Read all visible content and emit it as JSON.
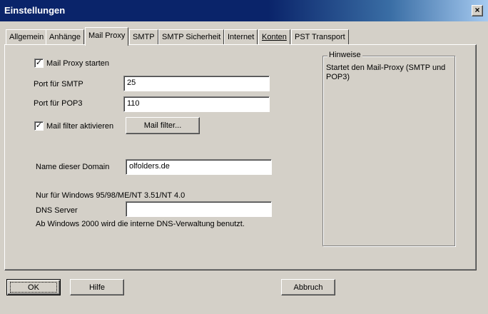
{
  "window": {
    "title": "Einstellungen"
  },
  "tabs": [
    {
      "label": "Allgemein"
    },
    {
      "label": "Anhänge"
    },
    {
      "label": "Mail Proxy"
    },
    {
      "label": "SMTP"
    },
    {
      "label": "SMTP Sicherheit"
    },
    {
      "label": "Internet"
    },
    {
      "label": "Konten"
    },
    {
      "label": "PST Transport"
    }
  ],
  "active_tab": "Mail Proxy",
  "mail_proxy": {
    "start_checkbox": {
      "label": "Mail Proxy starten",
      "checked": "✓"
    },
    "smtp_port": {
      "label": "Port für SMTP",
      "value": "25"
    },
    "pop3_port": {
      "label": "Port für POP3",
      "value": "110"
    },
    "filter_checkbox": {
      "label": "Mail filter aktivieren",
      "checked": "✓"
    },
    "filter_button": {
      "label": "Mail filter..."
    },
    "domain": {
      "label": "Name dieser Domain",
      "value": "olfolders.de"
    },
    "windows_note": "Nur für Windows 95/98/ME/NT 3.51/NT 4.0",
    "dns": {
      "label": "DNS Server",
      "value": ""
    },
    "dns_note": "Ab Windows 2000 wird die interne DNS-Verwaltung benutzt."
  },
  "hints": {
    "title": "Hinweise",
    "text": "Startet den Mail-Proxy (SMTP und POP3)"
  },
  "buttons": {
    "ok": "OK",
    "help": "Hilfe",
    "cancel": "Abbruch"
  }
}
